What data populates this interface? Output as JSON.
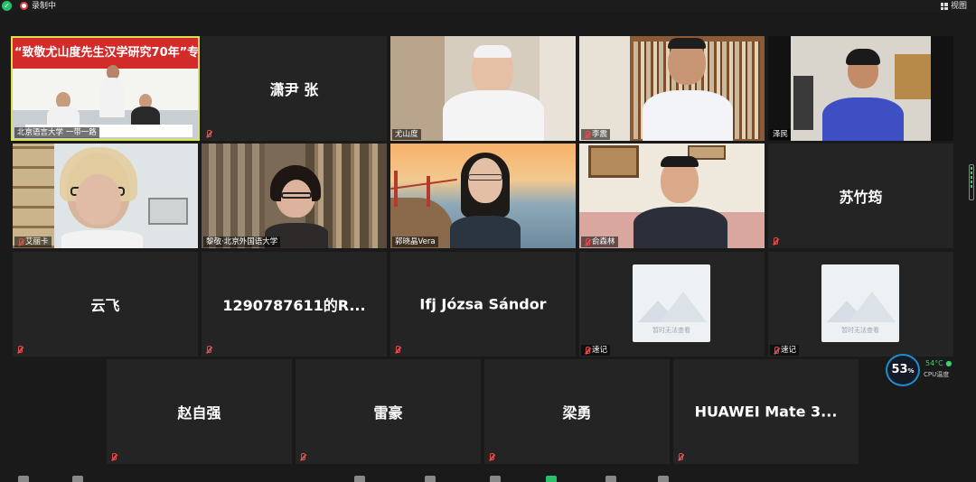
{
  "topbar": {
    "recording_label": "录制中",
    "view_label": "视图"
  },
  "tiles": [
    {
      "label": "北京语言大学 一带一路",
      "banner": "“致敬尤山度先生汉学研究70年”专"
    },
    {
      "name": "潇尹 张"
    },
    {
      "label": "尤山度"
    },
    {
      "label": "李震"
    },
    {
      "label": "泽民"
    },
    {
      "label": "艾丽卡"
    },
    {
      "label": "黎敬·北京外国语大学"
    },
    {
      "label": "郭晓晶Vera"
    },
    {
      "label": "俞森林"
    },
    {
      "name": "苏竹筠"
    },
    {
      "name": "云飞"
    },
    {
      "name": "1290787611的R..."
    },
    {
      "name": "Ifj Józsa Sándor"
    },
    {
      "label": "速记",
      "placeholder": "暂时无法查看"
    },
    {
      "label": "速记",
      "placeholder": "暂时无法查看"
    },
    {
      "name": "赵自强"
    },
    {
      "name": "雷豪"
    },
    {
      "name": "梁勇"
    },
    {
      "name": "HUAWEI Mate 3..."
    }
  ],
  "cpu": {
    "usage": "53",
    "usage_unit": "%",
    "temperature": "54°C",
    "label": "CPU温度"
  },
  "colors": {
    "active_speaker": "#d8e24a",
    "muted_mic": "#e24b4b",
    "cpu_ring": "#1d8fd0"
  }
}
